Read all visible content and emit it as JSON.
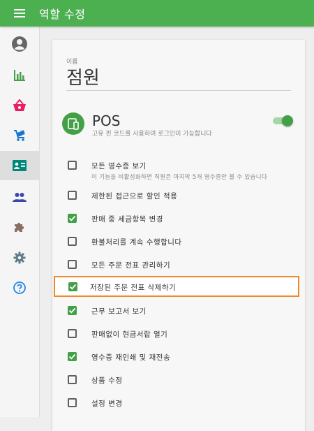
{
  "appbar": {
    "title": "역할 수정",
    "menu_icon": "menu-icon",
    "color": "#4caf50"
  },
  "sidebar": {
    "items": [
      {
        "icon": "account-circle-icon",
        "color": "#666666",
        "active": false
      },
      {
        "icon": "bar-chart-icon",
        "color": "#43a047",
        "active": false
      },
      {
        "icon": "shopping-basket-icon",
        "color": "#e91e63",
        "active": false
      },
      {
        "icon": "cart-icon",
        "color": "#1976d2",
        "active": false
      },
      {
        "icon": "badge-card-icon",
        "color": "#00897b",
        "active": true
      },
      {
        "icon": "people-icon",
        "color": "#3949ab",
        "active": false
      },
      {
        "icon": "puzzle-icon",
        "color": "#8d6e63",
        "active": false
      },
      {
        "icon": "gear-icon",
        "color": "#607d8b",
        "active": false
      },
      {
        "icon": "help-icon",
        "color": "#1e88e5",
        "active": false
      }
    ]
  },
  "form": {
    "name_label": "이름",
    "name_value": "점원",
    "pos": {
      "title": "POS",
      "description": "고유 핀 코드를 사용하여 로그인이 가능합니다",
      "enabled": true,
      "icon": "tablet-icon"
    },
    "permissions": [
      {
        "label": "모든 영수증 보기",
        "description": "이 기능을 비활성화하면 직원은 마지막 5개 영수증만 볼 수 있습니다",
        "checked": false
      },
      {
        "label": "제한된 접근으로 할인 적용",
        "checked": false
      },
      {
        "label": "판매 중 세금항목 변경",
        "checked": true
      },
      {
        "label": "환불처리를 계속 수행합니다",
        "checked": false
      },
      {
        "label": "모든 주문 전표 관리하기",
        "checked": false
      },
      {
        "label": "저장된 주문 전표 삭제하기",
        "checked": true,
        "highlighted": true
      },
      {
        "label": "근무 보고서 보기",
        "checked": true
      },
      {
        "label": "판매없이 현금서랍 열기",
        "checked": false
      },
      {
        "label": "영수증 재인쇄 및 재전송",
        "checked": true
      },
      {
        "label": "상품 수정",
        "checked": false
      },
      {
        "label": "설정 변경",
        "checked": false
      }
    ]
  },
  "colors": {
    "accent": "#43a047",
    "highlight_border": "#ef8a2b"
  }
}
